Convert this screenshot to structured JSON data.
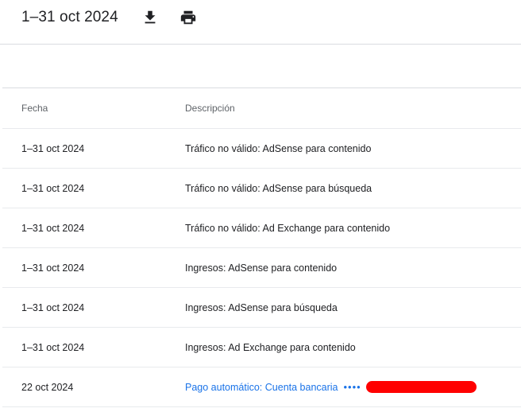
{
  "header": {
    "title": "1–31 oct 2024",
    "download_icon": "download-icon",
    "print_icon": "print-icon"
  },
  "table": {
    "columns": [
      "Fecha",
      "Descripción"
    ],
    "rows": [
      {
        "date": "1–31 oct 2024",
        "description": "Tráfico no válido: AdSense para contenido"
      },
      {
        "date": "1–31 oct 2024",
        "description": "Tráfico no válido: AdSense para búsqueda"
      },
      {
        "date": "1–31 oct 2024",
        "description": "Tráfico no válido: Ad Exchange para contenido"
      },
      {
        "date": "1–31 oct 2024",
        "description": "Ingresos: AdSense para contenido"
      },
      {
        "date": "1–31 oct 2024",
        "description": "Ingresos: AdSense para búsqueda"
      },
      {
        "date": "1–31 oct 2024",
        "description": "Ingresos: Ad Exchange para contenido"
      },
      {
        "date": "22 oct 2024",
        "description": "Pago automático: Cuenta bancaria",
        "masked_dots": "••••"
      }
    ]
  },
  "colors": {
    "link": "#1a73e8",
    "redaction": "#ff0000",
    "divider": "#dadce0"
  }
}
